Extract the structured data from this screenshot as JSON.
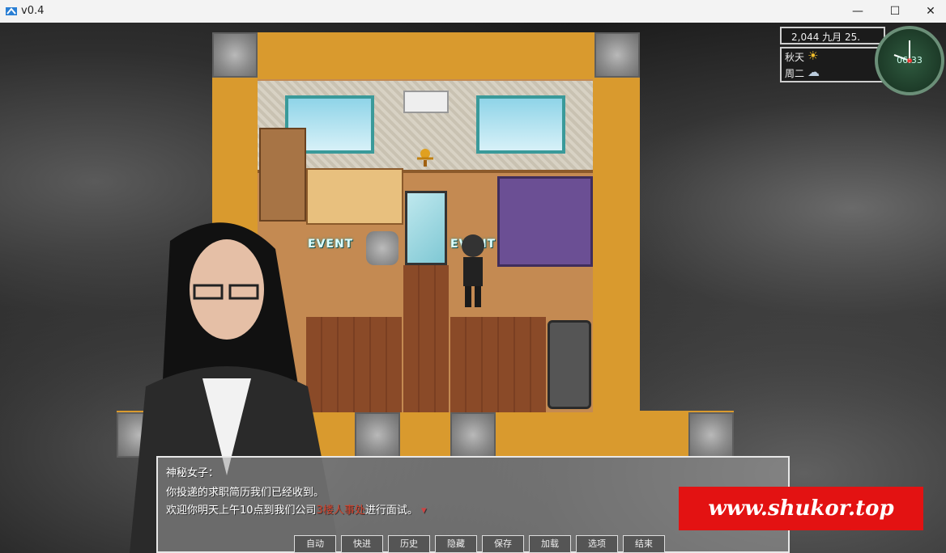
{
  "window": {
    "title": "v0.4",
    "minimize": "—",
    "maximize": "☐",
    "close": "✕"
  },
  "hud": {
    "date": "2,044 九月 25.",
    "season": "秋天",
    "weekday": "周二",
    "time": "06:33",
    "season_icon": "sun-icon",
    "weather_icon": "rain-cloud-icon"
  },
  "map": {
    "event_labels": [
      "EVENT",
      "EVENT"
    ]
  },
  "dialog": {
    "speaker": "神秘女子：",
    "line1": "你投递的求职简历我们已经收到。",
    "line2_pre": "欢迎你明天上午10点到我们公司",
    "line2_hl": "3楼人事处",
    "line2_post": "进行面试。"
  },
  "menu": [
    "自动",
    "快进",
    "历史",
    "隐藏",
    "保存",
    "加载",
    "选项",
    "结束"
  ],
  "watermark": "www.shukor.top",
  "colors": {
    "highlight": "#d0402a",
    "watermark_bg": "#e31212",
    "floor": "#d99a2e"
  }
}
